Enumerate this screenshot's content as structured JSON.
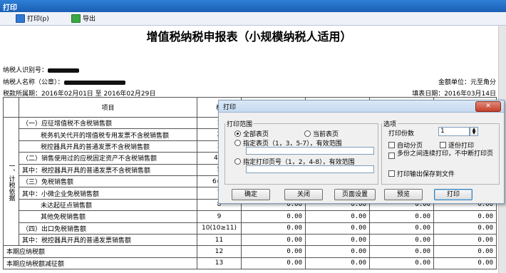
{
  "window": {
    "title": "打印"
  },
  "toolbar": {
    "print_label": "打印(p)",
    "export_label": "导出"
  },
  "report": {
    "title": "增值税纳税申报表（小规模纳税人适用）",
    "taxpayer_id_label": "纳税人识别号：",
    "taxpayer_name_label": "纳税人名称（公章）：",
    "amount_unit": "金额单位：元至角分",
    "period": "税款所属期：2016年02月01日 至 2016年02月29日",
    "fill_date": "填表日期：2016年03月14日",
    "header_item": "项目",
    "header_col": "栏",
    "side_label": "一、计税依据",
    "rows": [
      {
        "item": "（一）应征增值税不含税销售额",
        "line": "1",
        "v1": "",
        "v2": "",
        "v3": "",
        "v4": ""
      },
      {
        "item": "税务机关代开的增值税专用发票不含税销售额",
        "line": "2",
        "v1": "",
        "v2": "",
        "v3": "",
        "v4": ""
      },
      {
        "item": "税控器具开具的普通发票不含税销售额",
        "line": "3",
        "v1": "",
        "v2": "",
        "v3": "",
        "v4": ""
      },
      {
        "item": "（二）销售使用过的应税固定资产不含税销售额",
        "line": "4(4",
        "v1": "",
        "v2": "",
        "v3": "",
        "v4": ""
      },
      {
        "item": "其中：税控器具开具的普通发票不含税销售额",
        "line": "5",
        "v1": "",
        "v2": "",
        "v3": "",
        "v4": ""
      },
      {
        "item": "（三）免税销售额",
        "line": "6=7",
        "v1": "",
        "v2": "",
        "v3": "",
        "v4": ""
      },
      {
        "item": "其中：小微企业免税销售额",
        "line": "7",
        "v1": "",
        "v2": "",
        "v3": "",
        "v4": ""
      },
      {
        "item": "未达起征点销售额",
        "line": "8",
        "v1": "0.00",
        "v2": "0.00",
        "v3": "0.00",
        "v4": "0.00"
      },
      {
        "item": "其他免税销售额",
        "line": "9",
        "v1": "0.00",
        "v2": "0.00",
        "v3": "0.00",
        "v4": "0.00"
      },
      {
        "item": "（四）出口免税销售额",
        "line": "10(10≥11)",
        "v1": "0.00",
        "v2": "0.00",
        "v3": "0.00",
        "v4": "0.00"
      },
      {
        "item": "其中：税控器具开具的普通发票销售额",
        "line": "11",
        "v1": "0.00",
        "v2": "0.00",
        "v3": "0.00",
        "v4": "0.00"
      },
      {
        "item": "本期应纳税额",
        "line": "12",
        "v1": "0.00",
        "v2": "0.00",
        "v3": "0.00",
        "v4": "0.00"
      },
      {
        "item": "本期应纳税额减征额",
        "line": "13",
        "v1": "0.00",
        "v2": "0.00",
        "v3": "0.00",
        "v4": "0.00"
      }
    ]
  },
  "dialog": {
    "title": "打印",
    "range_legend": "打印范围",
    "opt_all": "全部表页",
    "opt_current": "当前表页",
    "opt_specify": "指定表页（1，3，5-7），有效范围",
    "opt_pages": "指定打印页号（1，2，4-8），有效范围",
    "options_legend": "选项",
    "copies_label": "打印份数",
    "copies_value": "1",
    "auto_page": "自动分页",
    "page_by_page": "逐份打印",
    "continuous": "多份之间连续打印，不中断打印页",
    "save_output": "打印输出保存到文件",
    "btn_ok": "确定",
    "btn_close": "关闭",
    "btn_setup": "页面设置",
    "btn_preview": "预览",
    "btn_print": "打印"
  }
}
